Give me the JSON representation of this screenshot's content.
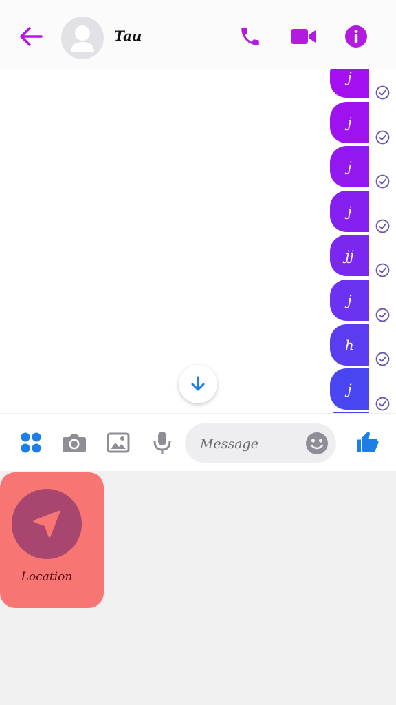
{
  "header": {
    "contact_name": "Tau",
    "icons": [
      "back-arrow-icon",
      "avatar-placeholder-icon",
      "phone-icon",
      "video-camera-icon",
      "info-icon"
    ]
  },
  "messages": [
    {
      "text": "j",
      "status": "sent"
    },
    {
      "text": "j",
      "status": "sent"
    },
    {
      "text": "j",
      "status": "sent"
    },
    {
      "text": "j",
      "status": "sent"
    },
    {
      "text": "jj",
      "status": "sent"
    },
    {
      "text": "j",
      "status": "sent"
    },
    {
      "text": "h",
      "status": "sent"
    },
    {
      "text": "j",
      "status": "sent"
    }
  ],
  "composer": {
    "placeholder": "Message",
    "icons": [
      "apps-grid-icon",
      "camera-icon",
      "image-icon",
      "microphone-icon",
      "emoji-icon",
      "thumbs-up-icon"
    ]
  },
  "drawer": {
    "items": [
      {
        "label": "Location",
        "icon": "location-arrow-icon"
      }
    ]
  },
  "colors": {
    "accent": "#b21ae0",
    "bubble_top": "#a50ef0",
    "bubble_bottom": "#4348f2",
    "blue": "#1d7fe6",
    "gray_icon": "#8e8e96",
    "location_tile": "#f77673",
    "location_circle": "#a9466f"
  }
}
